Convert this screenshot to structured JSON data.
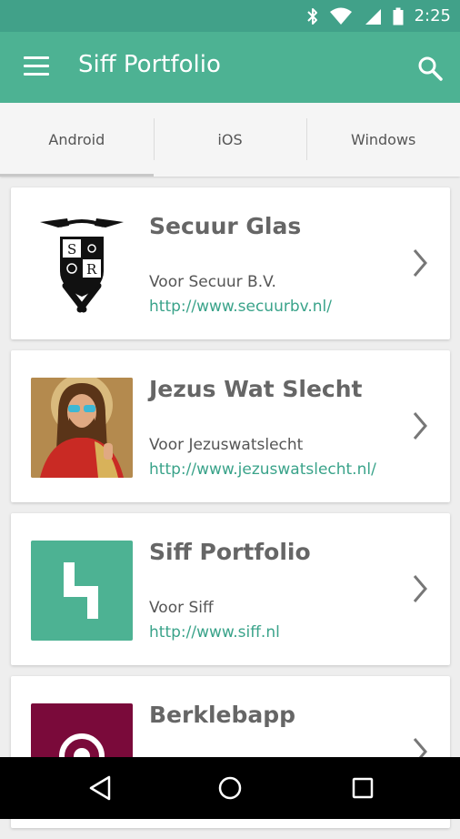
{
  "status_bar": {
    "time": "2:25",
    "icons": [
      "bluetooth-icon",
      "wifi-icon",
      "signal-icon",
      "battery-icon"
    ]
  },
  "app_bar": {
    "title": "Siff Portfolio",
    "menu_icon": "menu-icon",
    "search_icon": "search-icon"
  },
  "tabs": [
    {
      "label": "Android",
      "active": true
    },
    {
      "label": "iOS",
      "active": false
    },
    {
      "label": "Windows",
      "active": false
    }
  ],
  "projects": [
    {
      "title": "Secuur Glas",
      "subtitle": "Voor Secuur B.V.",
      "url": "http://www.secuurbv.nl/",
      "logo_text": "S R"
    },
    {
      "title": "Jezus Wat Slecht",
      "subtitle": "Voor Jezuswatslecht",
      "url": "http://www.jezuswatslecht.nl/"
    },
    {
      "title": "Siff Portfolio",
      "subtitle": "Voor Siff",
      "url": "http://www.siff.nl"
    },
    {
      "title": "Berklebapp",
      "subtitle": "",
      "url": ""
    }
  ],
  "colors": {
    "status_bar": "#41a189",
    "app_bar": "#4db293",
    "accent_link": "#3aa38a",
    "siff_logo": "#4db293",
    "berklebapp_logo": "#7a0a3a"
  },
  "nav_bar": {
    "buttons": [
      "back-icon",
      "home-icon",
      "recents-icon"
    ]
  }
}
